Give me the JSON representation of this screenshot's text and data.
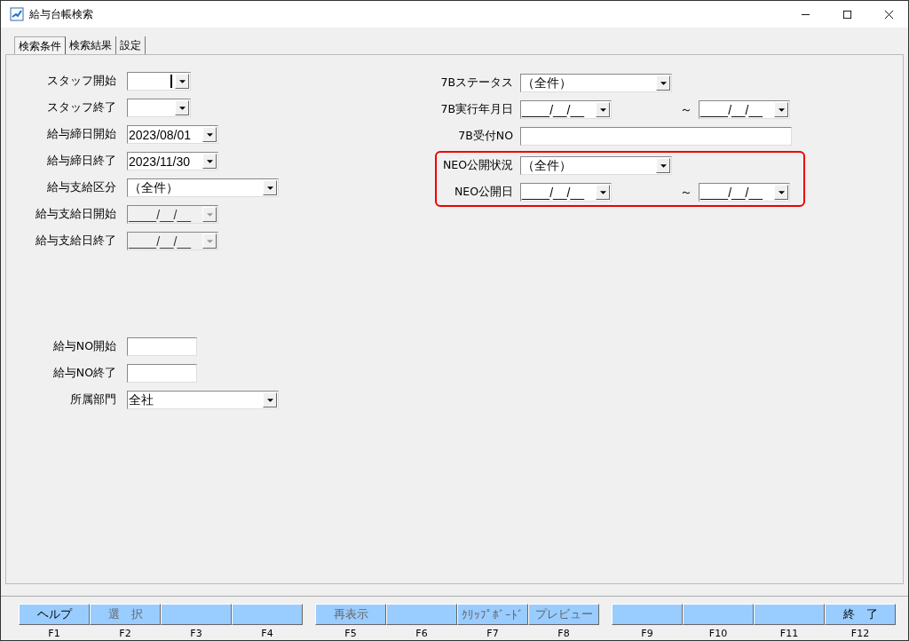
{
  "window": {
    "title": "給与台帳検索"
  },
  "tabs": [
    {
      "label": "検索条件",
      "selected": true
    },
    {
      "label": "検索結果",
      "selected": false
    },
    {
      "label": "設定",
      "selected": false
    }
  ],
  "left_fields": [
    {
      "label": "スタッフ開始",
      "kind": "short-combo",
      "focused": true,
      "disabled": false
    },
    {
      "label": "スタッフ終了",
      "kind": "short-combo",
      "disabled": false
    },
    {
      "label": "給与締日開始",
      "kind": "date",
      "value": "2023/08/01",
      "disabled": false
    },
    {
      "label": "給与締日終了",
      "kind": "date",
      "value": "2023/11/30",
      "disabled": false
    },
    {
      "label": "給与支給区分",
      "kind": "combo",
      "value": "（全件）",
      "disabled": false
    },
    {
      "label": "給与支給日開始",
      "kind": "date",
      "value": "____/__/__",
      "disabled": true
    },
    {
      "label": "給与支給日終了",
      "kind": "date",
      "value": "____/__/__",
      "disabled": true
    }
  ],
  "left_fields_lower": [
    {
      "label": "給与NO開始",
      "kind": "text"
    },
    {
      "label": "給与NO終了",
      "kind": "text"
    },
    {
      "label": "所属部門",
      "kind": "combo",
      "value": "全社"
    }
  ],
  "right_groups": [
    {
      "highlighted": false,
      "fields": [
        {
          "label": "7Bステータス",
          "kind": "combo",
          "value": "（全件）"
        },
        {
          "label": "7B実行年月日",
          "kind": "date",
          "value": "____/__/__",
          "range": {
            "separator": "～",
            "value": "____/__/__"
          }
        },
        {
          "label": "7B受付NO",
          "kind": "wide-text"
        }
      ]
    },
    {
      "highlighted": true,
      "fields": [
        {
          "label": "NEO公開状況",
          "kind": "combo",
          "value": "（全件）"
        },
        {
          "label": "NEO公開日",
          "kind": "date",
          "value": "____/__/__",
          "range": {
            "separator": "～",
            "value": "____/__/__"
          }
        }
      ]
    }
  ],
  "function_key_groups": [
    [
      {
        "label": "ヘルプ",
        "key": "F1",
        "disabled": false
      },
      {
        "label": "選　択",
        "key": "F2",
        "disabled": true
      },
      {
        "key": "F3"
      },
      {
        "key": "F4"
      }
    ],
    [
      {
        "label": "再表示",
        "key": "F5",
        "disabled": true
      },
      {
        "key": "F6"
      },
      {
        "label": "ｸﾘｯﾌﾟﾎﾞｰﾄﾞ",
        "key": "F7",
        "disabled": true
      },
      {
        "label": "プレビュー",
        "key": "F8",
        "disabled": true
      }
    ],
    [
      {
        "key": "F9"
      },
      {
        "key": "F10"
      },
      {
        "key": "F11"
      },
      {
        "label": "終　了",
        "key": "F12",
        "disabled": false
      }
    ]
  ]
}
